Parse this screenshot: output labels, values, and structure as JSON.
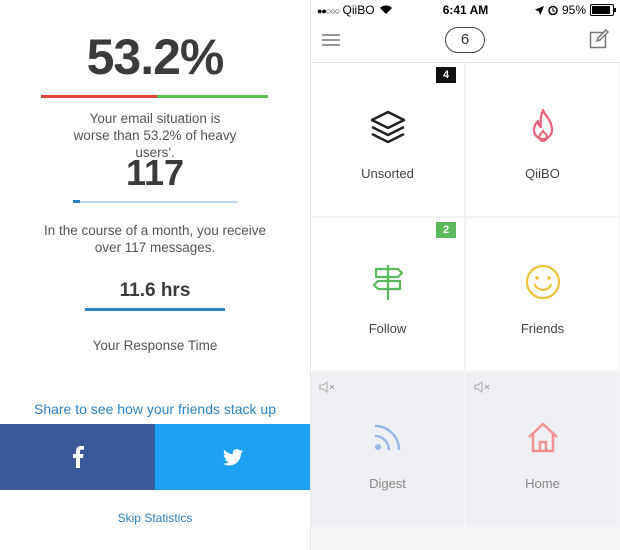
{
  "stats": {
    "percent_value": "53.2%",
    "percent_desc": "Your email situation is worse than 53.2% of heavy users'.",
    "messages_value": "117",
    "messages_desc": "In the course of a month, you receive over 117 messages.",
    "response_value": "11.6 hrs",
    "response_desc": "Your Response Time",
    "share_text": "Share to see how your friends stack up",
    "skip_label": "Skip Statistics",
    "facebook_icon": "facebook-icon",
    "twitter_icon": "twitter-icon"
  },
  "status_bar": {
    "carrier": "QiiBO",
    "time": "6:41 AM",
    "battery": "95%"
  },
  "nav": {
    "count": "6",
    "menu_icon": "menu-icon",
    "compose_icon": "compose-icon"
  },
  "tiles": [
    {
      "label": "Unsorted",
      "badge": "4",
      "badge_color": "#111111",
      "icon": "layers-icon"
    },
    {
      "label": "QiiBO",
      "badge": "",
      "icon": "flame-icon",
      "icon_color": "#e8607a"
    },
    {
      "label": "Follow",
      "badge": "2",
      "badge_color": "#5cb85c",
      "icon": "signpost-icon",
      "icon_color": "#5cb85c"
    },
    {
      "label": "Friends",
      "badge": "",
      "icon": "smiley-icon",
      "icon_color": "#f0c23b"
    },
    {
      "label": "Digest",
      "badge": "",
      "icon": "rss-icon",
      "icon_color": "#9ab8e8",
      "muted": true
    },
    {
      "label": "Home",
      "badge": "",
      "icon": "home-icon",
      "icon_color": "#f09090",
      "muted": true
    }
  ],
  "colors": {
    "accent_blue": "#2b83c6",
    "facebook": "#3b5998",
    "twitter": "#1da1f2"
  }
}
